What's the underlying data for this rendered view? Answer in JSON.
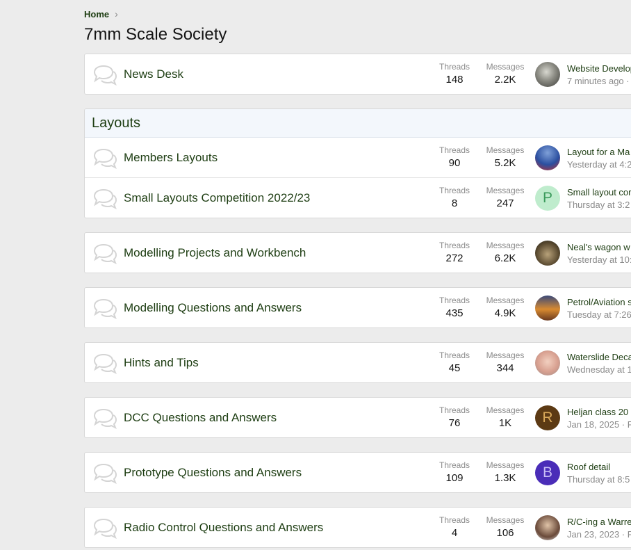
{
  "breadcrumb": {
    "home": "Home"
  },
  "page_title": "7mm Scale Society",
  "stat_labels": {
    "threads": "Threads",
    "messages": "Messages"
  },
  "colors": {
    "link": "#1d3d12",
    "muted": "#8a8a8a",
    "category_bg": "#f3f7fc"
  },
  "blocks": [
    {
      "nodes": [
        {
          "title": "News Desk",
          "threads": "148",
          "messages": "2.2K",
          "latest_title": "Website Development",
          "latest_meta": "7 minutes ago ·",
          "avatar": {
            "type": "photo",
            "icon": "user-photo-icon"
          }
        }
      ]
    },
    {
      "header": "Layouts",
      "nodes": [
        {
          "title": "Members Layouts",
          "threads": "90",
          "messages": "5.2K",
          "latest_title": "Layout for a Ma",
          "latest_meta": "Yesterday at 4:2",
          "avatar": {
            "type": "photo",
            "icon": "user-photo-icon"
          }
        },
        {
          "title": "Small Layouts Competition 2022/23",
          "threads": "8",
          "messages": "247",
          "latest_title": "Small layout cor",
          "latest_meta": "Thursday at 3:2",
          "avatar": {
            "type": "letter",
            "letter": "P",
            "bg": "#bfeccd",
            "fg": "#3a9a5b"
          }
        }
      ]
    },
    {
      "nodes": [
        {
          "title": "Modelling Projects and Workbench",
          "threads": "272",
          "messages": "6.2K",
          "latest_title": "Neal's wagon w",
          "latest_meta": "Yesterday at 10:",
          "avatar": {
            "type": "photo",
            "icon": "user-photo-icon"
          }
        }
      ]
    },
    {
      "nodes": [
        {
          "title": "Modelling Questions and Answers",
          "threads": "435",
          "messages": "4.9K",
          "latest_title": "Petrol/Aviation s",
          "latest_meta": "Tuesday at 7:26",
          "avatar": {
            "type": "photo",
            "icon": "user-photo-icon"
          }
        }
      ]
    },
    {
      "nodes": [
        {
          "title": "Hints and Tips",
          "threads": "45",
          "messages": "344",
          "latest_title": "Waterslide Deca",
          "latest_meta": "Wednesday at 1",
          "avatar": {
            "type": "photo",
            "icon": "user-photo-icon"
          }
        }
      ]
    },
    {
      "nodes": [
        {
          "title": "DCC Questions and Answers",
          "threads": "76",
          "messages": "1K",
          "latest_title": "Heljan class 20",
          "latest_meta": "Jan 18, 2025 · F",
          "avatar": {
            "type": "letter",
            "letter": "R",
            "bg": "#5c3a14",
            "fg": "#d9a85a"
          }
        }
      ]
    },
    {
      "nodes": [
        {
          "title": "Prototype Questions and Answers",
          "threads": "109",
          "messages": "1.3K",
          "latest_title": "Roof detail",
          "latest_meta": "Thursday at 8:5",
          "avatar": {
            "type": "letter",
            "letter": "B",
            "bg": "#4a2db8",
            "fg": "#c8bcf5"
          }
        }
      ]
    },
    {
      "nodes": [
        {
          "title": "Radio Control Questions and Answers",
          "threads": "4",
          "messages": "106",
          "latest_title": "R/C-ing a Warre",
          "latest_meta": "Jan 23, 2023 · F",
          "avatar": {
            "type": "photo",
            "icon": "user-photo-icon"
          }
        }
      ]
    }
  ]
}
